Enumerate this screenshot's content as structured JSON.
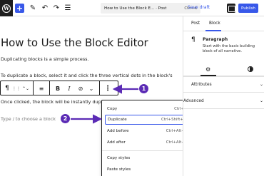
{
  "topbar": {
    "add_label": "+",
    "edit_icon": "pencil-icon",
    "undo_icon": "undo-icon",
    "redo_icon": "redo-icon",
    "list_view_icon": "list-view-icon",
    "doc_title": "How to Use the Block E...",
    "doc_type": "· Post",
    "doc_shortcut": "Ctrl+K",
    "save_draft": "Save draft",
    "publish": "Publish",
    "accent_color": "#3858e9"
  },
  "sidebar": {
    "tabs": [
      "Post",
      "Block"
    ],
    "active_tab": "Block",
    "block_name": "Paragraph",
    "block_desc": "Start with the basic building block of all narrative.",
    "pilcrow": "¶",
    "settings_icon": "⚙",
    "sections": [
      {
        "label": "Attributes",
        "chev": "⌄"
      },
      {
        "label": "Advanced",
        "chev": "⌄"
      }
    ]
  },
  "editor": {
    "heading": "How to Use the Block Editor",
    "para1": "Duplicating blocks is a simple process.",
    "para2": "To duplicate a block, select it and click the three vertical dots in the block's",
    "para3": "Once clicked, the block will be instantly duplica",
    "placeholder": "Type / to choose a block"
  },
  "block_toolbar": {
    "transform": "¶",
    "drag": "⋮⋮",
    "move": "⌃⌄",
    "align": "≡",
    "bold": "B",
    "italic": "I",
    "link": "⊘",
    "more": "⌄",
    "options": "⋮"
  },
  "dropdown": {
    "items": [
      {
        "label": "Copy",
        "shortcut": "Ctrl+C"
      },
      {
        "label": "Duplicate",
        "shortcut": "Ctrl+Shift+D"
      },
      {
        "label": "Add before",
        "shortcut": "Ctrl+Alt+T"
      },
      {
        "label": "Add after",
        "shortcut": "Ctrl+Alt+Y"
      },
      {
        "label": "Copy styles",
        "shortcut": ""
      },
      {
        "label": "Paste styles",
        "shortcut": ""
      }
    ],
    "highlighted": "Duplicate"
  },
  "callouts": {
    "one": "1",
    "two": "2",
    "color": "#5b2bb5"
  }
}
